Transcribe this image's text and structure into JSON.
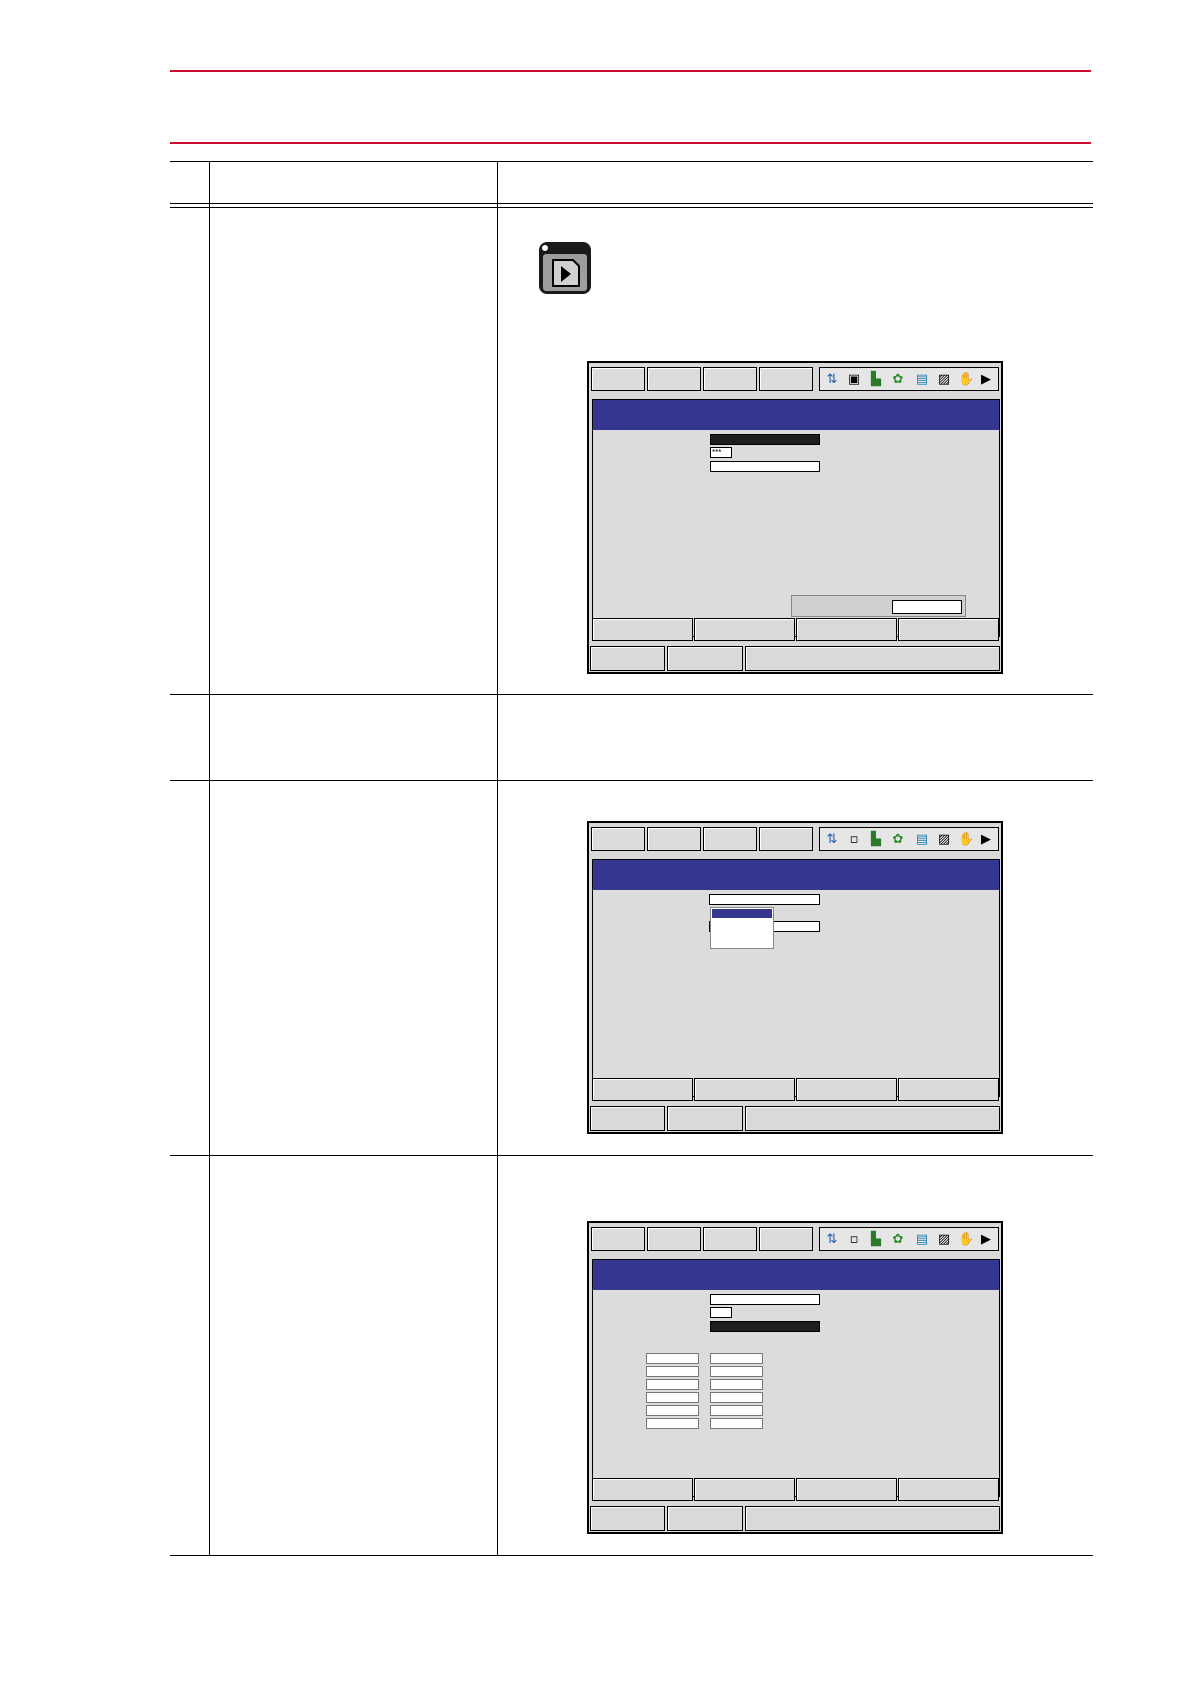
{
  "screens": [
    {
      "field_text": "***"
    },
    {
      "field_text": ""
    },
    {
      "field_text": ""
    }
  ],
  "icons": {
    "play_key": "play-key-icon",
    "status": [
      "coordinate-icon",
      "tool-icon",
      "step-icon",
      "cycle-icon",
      "io-icon",
      "save-icon",
      "lock-icon",
      "play-icon"
    ]
  }
}
